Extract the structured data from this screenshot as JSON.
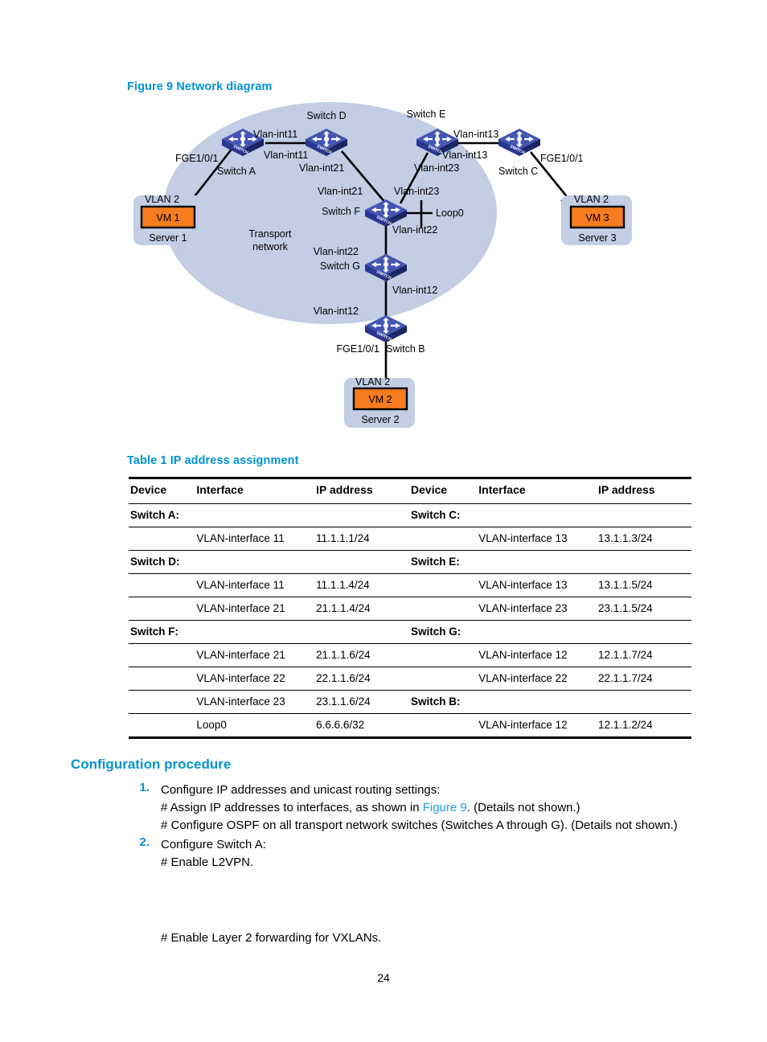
{
  "figure": {
    "caption": "Figure 9 Network diagram",
    "cloud_label_line1": "Transport",
    "cloud_label_line2": "network",
    "nodes": {
      "switch_a": "Switch A",
      "switch_b": "Switch B",
      "switch_c": "Switch C",
      "switch_d": "Switch D",
      "switch_e": "Switch E",
      "switch_f": "Switch F",
      "switch_g": "Switch G"
    },
    "servers": [
      {
        "vlan": "VLAN 2",
        "vm": "VM 1",
        "name": "Server 1"
      },
      {
        "vlan": "VLAN 2",
        "vm": "VM 2",
        "name": "Server 2"
      },
      {
        "vlan": "VLAN 2",
        "vm": "VM 3",
        "name": "Server 3"
      }
    ],
    "link_labels": {
      "a_access": "FGE1/0/1",
      "c_access": "FGE1/0/1",
      "b_access": "FGE1/0/1",
      "a_d_left": "Vlan-int11",
      "a_d_right": "Vlan-int11",
      "d_f_top": "Vlan-int21",
      "d_f_bottom": "Vlan-int21",
      "e_c_left": "Vlan-int13",
      "e_c_right": "Vlan-int13",
      "e_f_top": "Vlan-int23",
      "e_f_bottom": "Vlan-int23",
      "f_loop": "Loop0",
      "f_g_top": "Vlan-int22",
      "f_g_bottom": "Vlan-int22",
      "g_b_top": "Vlan-int12",
      "g_b_bottom": "Vlan-int12"
    },
    "colors": {
      "cloud": "#c3cee5",
      "switch_body": "#2e3d8f",
      "switch_top": "#4356b4",
      "server_box": "#c3cee5",
      "vm_box": "#f57c1f"
    }
  },
  "table": {
    "caption": "Table 1 IP address assignment",
    "headers": [
      "Device",
      "Interface",
      "IP address",
      "Device",
      "Interface",
      "IP address"
    ],
    "rows": [
      {
        "type": "device",
        "cells": [
          "Switch A:",
          "",
          "",
          "Switch C:",
          "",
          ""
        ]
      },
      {
        "type": "data",
        "cells": [
          "",
          "VLAN-interface 11",
          "11.1.1.1/24",
          "",
          "VLAN-interface 13",
          "13.1.1.3/24"
        ]
      },
      {
        "type": "device",
        "cells": [
          "Switch D:",
          "",
          "",
          "Switch E:",
          "",
          ""
        ]
      },
      {
        "type": "data",
        "cells": [
          "",
          "VLAN-interface 11",
          "11.1.1.4/24",
          "",
          "VLAN-interface 13",
          "13.1.1.5/24"
        ]
      },
      {
        "type": "data",
        "cells": [
          "",
          "VLAN-interface 21",
          "21.1.1.4/24",
          "",
          "VLAN-interface 23",
          "23.1.1.5/24"
        ]
      },
      {
        "type": "device",
        "cells": [
          "Switch F:",
          "",
          "",
          "Switch G:",
          "",
          ""
        ]
      },
      {
        "type": "data",
        "cells": [
          "",
          "VLAN-interface 21",
          "21.1.1.6/24",
          "",
          "VLAN-interface 12",
          "12.1.1.7/24"
        ]
      },
      {
        "type": "data",
        "cells": [
          "",
          "VLAN-interface 22",
          "22.1.1.6/24",
          "",
          "VLAN-interface 22",
          "22.1.1.7/24"
        ]
      },
      {
        "type": "mixed",
        "cells": [
          "",
          "VLAN-interface 23",
          "23.1.1.6/24",
          "Switch B:",
          "",
          ""
        ]
      },
      {
        "type": "data",
        "cells": [
          "",
          "Loop0",
          "6.6.6.6/32",
          "",
          "VLAN-interface 12",
          "12.1.1.2/24"
        ]
      }
    ]
  },
  "procedure": {
    "heading": "Configuration procedure",
    "steps": [
      {
        "num": "1.",
        "title": "Configure IP addresses and unicast routing settings:",
        "lines": [
          {
            "pre": "# Assign IP addresses to interfaces, as shown in ",
            "link": "Figure 9",
            "post": ". (Details not shown.)"
          },
          {
            "pre": "# Configure OSPF on all transport network switches (Switches A through G). (Details not shown.)",
            "link": "",
            "post": ""
          }
        ]
      },
      {
        "num": "2.",
        "title": "Configure Switch A:",
        "lines": [
          {
            "pre": "# Enable L2VPN.",
            "link": "",
            "post": ""
          }
        ]
      }
    ],
    "tail_line": "# Enable Layer 2 forwarding for VXLANs."
  },
  "page_number": "24"
}
